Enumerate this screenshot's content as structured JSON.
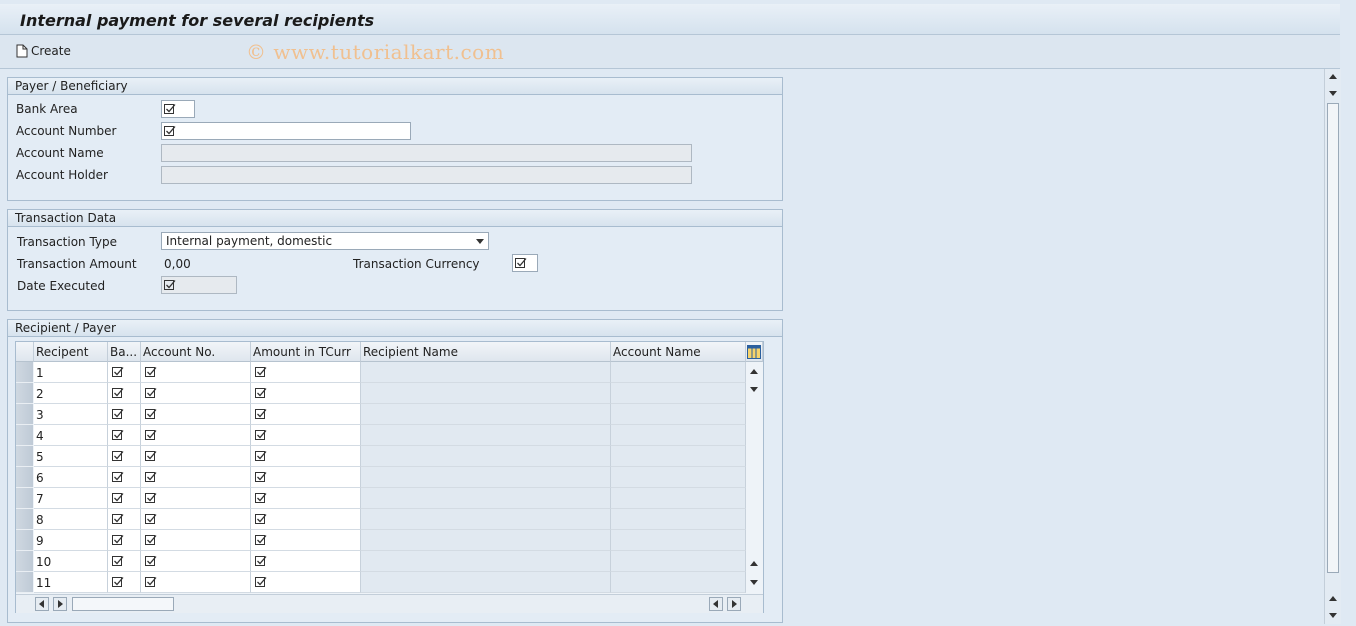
{
  "window": {
    "title": "Internal payment for several recipients"
  },
  "toolbar": {
    "create_label": "Create",
    "watermark": "© www.tutorialkart.com"
  },
  "payer": {
    "heading": "Payer / Beneficiary",
    "bank_area_label": "Bank Area",
    "account_number_label": "Account Number",
    "account_name_label": "Account Name",
    "account_holder_label": "Account Holder"
  },
  "transaction": {
    "heading": "Transaction Data",
    "type_label": "Transaction Type",
    "type_value": "Internal payment, domestic",
    "amount_label": "Transaction Amount",
    "amount_value": "0,00",
    "currency_label": "Transaction Currency",
    "date_label": "Date Executed"
  },
  "recipients": {
    "heading": "Recipient / Payer",
    "columns": [
      "Recipent",
      "Ba...",
      "Account No.",
      "Amount in TCurr",
      "Recipient Name",
      "Account Name"
    ],
    "rows": [
      "1",
      "2",
      "3",
      "4",
      "5",
      "6",
      "7",
      "8",
      "9",
      "10",
      "11"
    ]
  },
  "colors": {
    "background": "#dfe9f3",
    "group_border": "#a8bccf"
  },
  "icons": [
    "document-icon",
    "required-check-icon",
    "table-settings-icon",
    "scroll-up-icon",
    "scroll-down-icon",
    "scroll-left-icon",
    "scroll-right-icon"
  ]
}
